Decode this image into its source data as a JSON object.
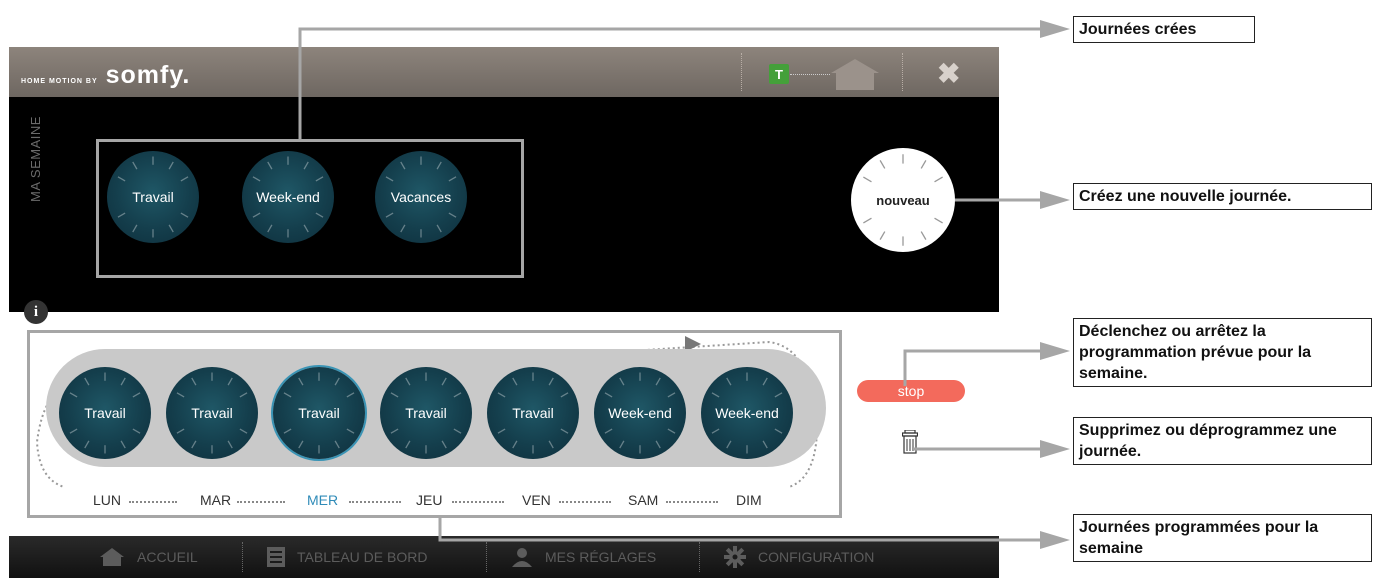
{
  "app": {
    "brand_small": "HOME MOTION BY",
    "brand_name": "somfy.",
    "toolbar": {
      "t_badge": "T",
      "close_glyph": "✖"
    },
    "week_panel": {
      "side_title": "MA SEMAINE",
      "created_days": [
        "Travail",
        "Week-end",
        "Vacances"
      ],
      "new_day_label": "nouveau"
    },
    "schedule": {
      "days": [
        {
          "dial": "Travail",
          "day": "LUN"
        },
        {
          "dial": "Travail",
          "day": "MAR"
        },
        {
          "dial": "Travail",
          "day": "MER"
        },
        {
          "dial": "Travail",
          "day": "JEU"
        },
        {
          "dial": "Travail",
          "day": "VEN"
        },
        {
          "dial": "Week-end",
          "day": "SAM"
        },
        {
          "dial": "Week-end",
          "day": "DIM"
        }
      ],
      "active_day": "MER",
      "active_color": "#2f8bb8",
      "stop_label": "stop",
      "stop_color": "#f36a5c",
      "info_glyph": "i"
    },
    "nav": [
      {
        "label": "ACCUEIL",
        "icon": "home-icon"
      },
      {
        "label": "TABLEAU DE BORD",
        "icon": "dashboard-icon"
      },
      {
        "label": "MES RÉGLAGES",
        "icon": "user-icon"
      },
      {
        "label": "CONFIGURATION",
        "icon": "gear-icon"
      }
    ]
  },
  "callouts": {
    "created": "Journées crées",
    "new": "Créez une nouvelle journée.",
    "toggle": "Déclenchez ou arrêtez la programmation prévue pour la semaine.",
    "delete": "Supprimez ou déprogrammez une journée.",
    "scheduled": "Journées programmées pour la semaine"
  }
}
